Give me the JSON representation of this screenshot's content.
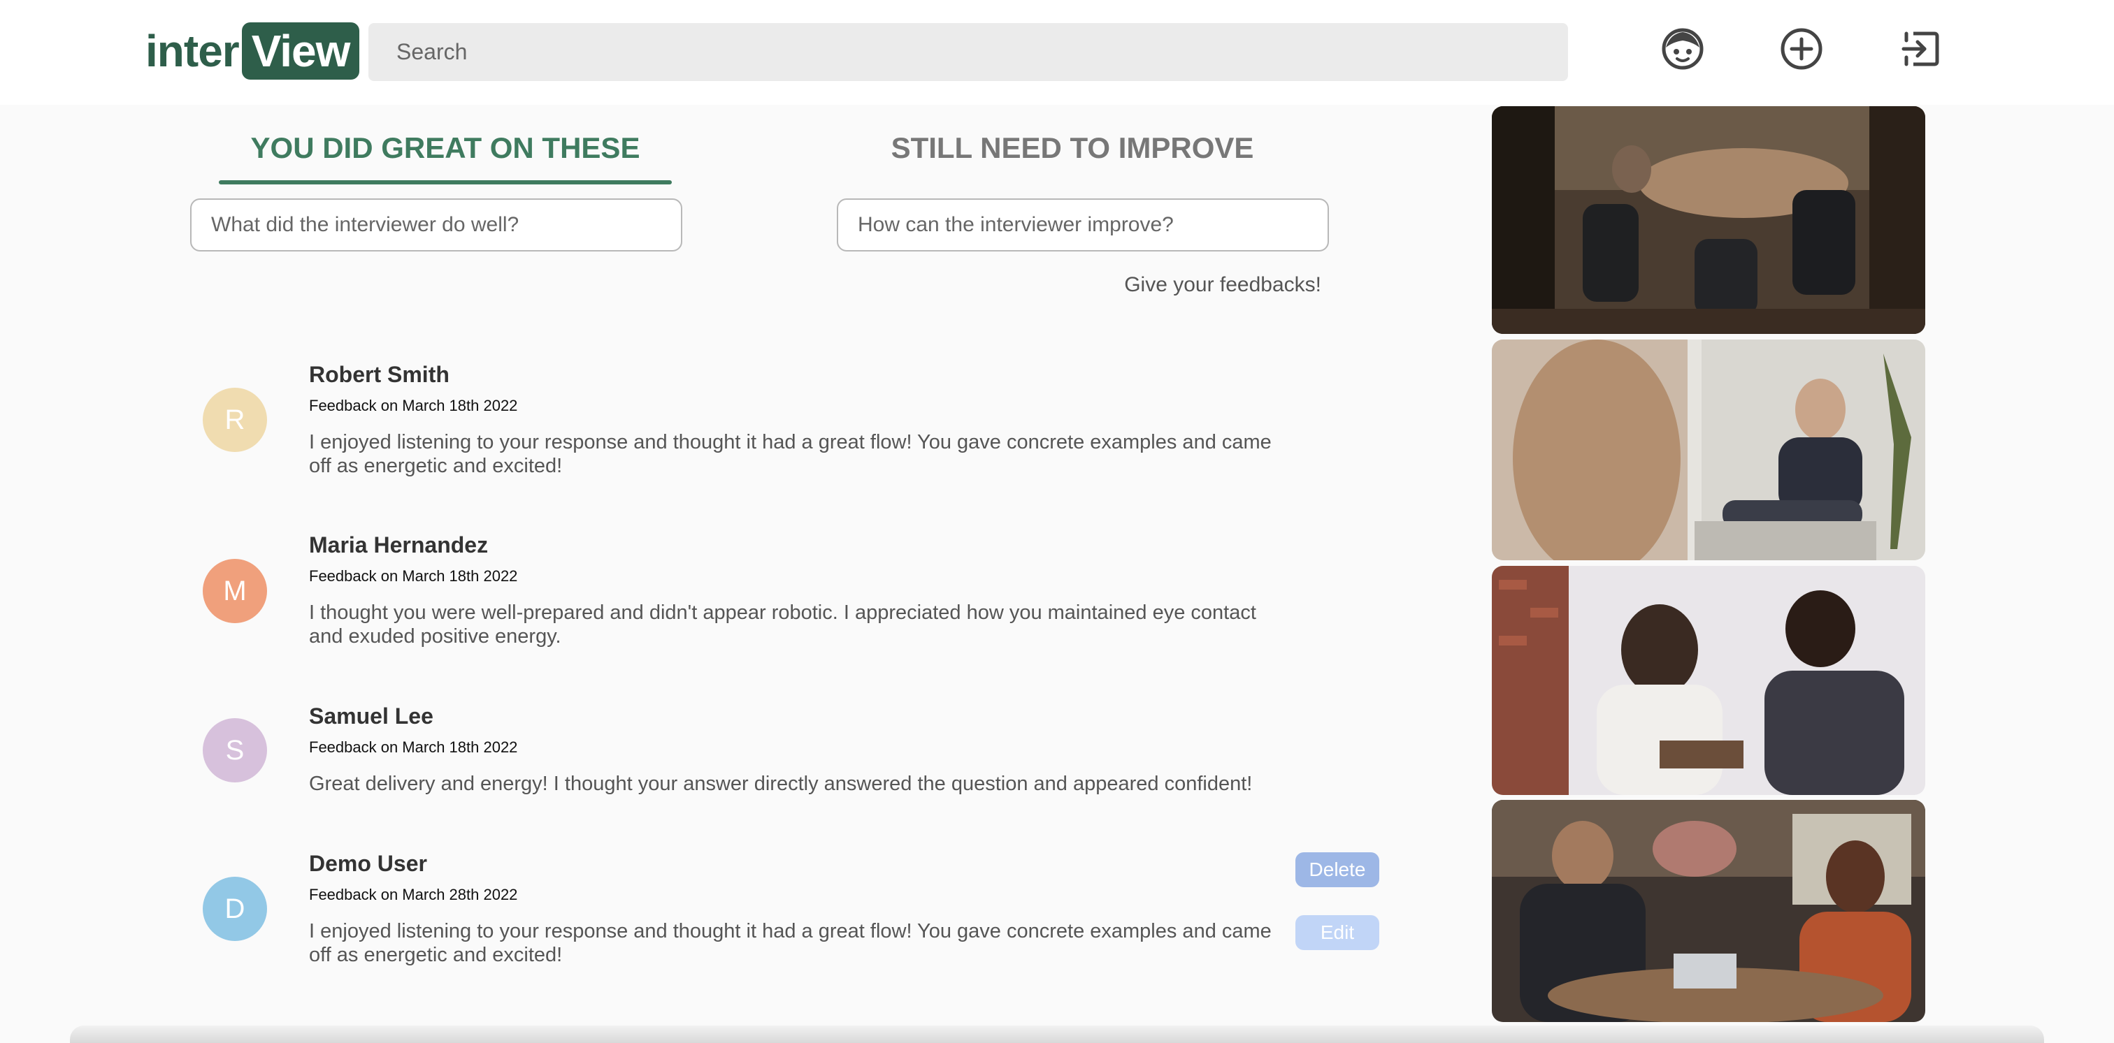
{
  "header": {
    "logo_part1": "inter",
    "logo_part2": "View",
    "search_placeholder": "Search",
    "icons": [
      "user-face-icon",
      "add-circle-icon",
      "logout-icon"
    ]
  },
  "tabs": {
    "great_label": "YOU DID GREAT ON THESE",
    "improve_label": "STILL NEED TO IMPROVE",
    "active": "great"
  },
  "inputs": {
    "well_placeholder": "What did the interviewer do well?",
    "improve_placeholder": "How can the interviewer improve?"
  },
  "give_feedback_label": "Give your feedbacks!",
  "feedback": [
    {
      "initial": "R",
      "name": "Robert Smith",
      "date": "Feedback on March 18th 2022",
      "text": "I enjoyed listening to your response and thought it had a great flow! You gave concrete examples and came off as energetic and excited!",
      "color": "#f0dcb0"
    },
    {
      "initial": "M",
      "name": "Maria Hernandez",
      "date": "Feedback on March 18th 2022",
      "text": "I thought you were well-prepared and didn't appear robotic. I appreciated how you maintained eye contact and exuded positive energy.",
      "color": "#f0a07c"
    },
    {
      "initial": "S",
      "name": "Samuel Lee",
      "date": "Feedback on March 18th 2022",
      "text": "Great delivery and energy! I thought your answer directly answered the question and appeared confident!",
      "color": "#d7c1dc"
    },
    {
      "initial": "D",
      "name": "Demo User",
      "date": "Feedback on March 28th 2022",
      "text": "I enjoyed listening to your response and thought it had a great flow! You gave concrete examples and came off as energetic and excited!",
      "color": "#92c8e6",
      "delete_label": "Delete",
      "edit_label": "Edit"
    }
  ],
  "colors": {
    "brand": "#2e5e4a",
    "active_tab": "#3f7b5f",
    "inactive_tab": "#777777"
  }
}
